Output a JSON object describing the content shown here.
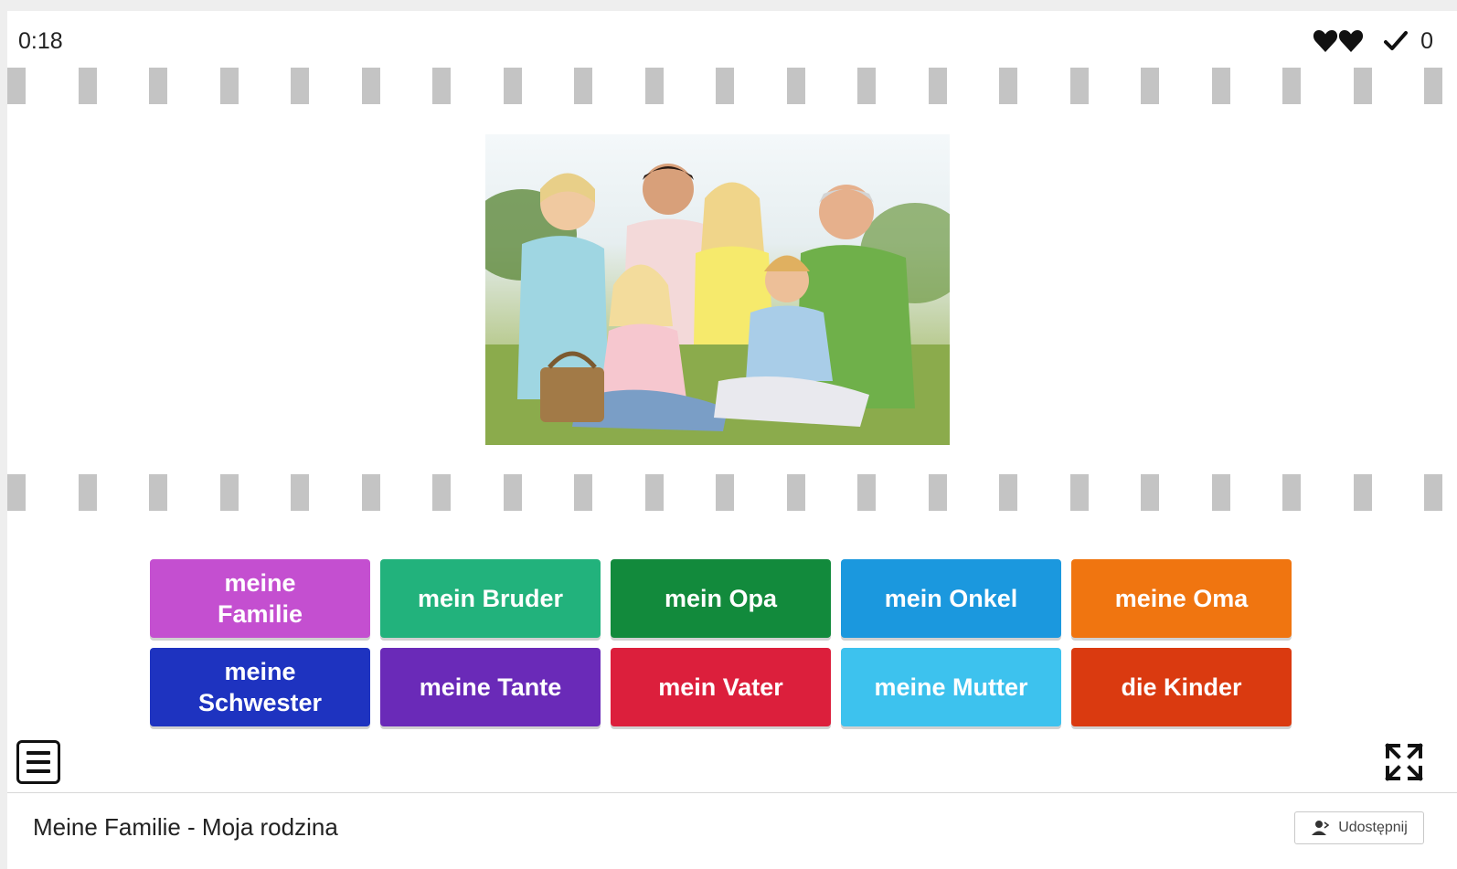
{
  "status": {
    "timer": "0:18",
    "lives": 2,
    "score": "0"
  },
  "image": {
    "alt": "family-photo"
  },
  "answers": [
    {
      "label": "meine Familie",
      "color": "#c44fd0"
    },
    {
      "label": "mein Bruder",
      "color": "#22b27c"
    },
    {
      "label": "mein Opa",
      "color": "#128a3c"
    },
    {
      "label": "mein Onkel",
      "color": "#1b98de"
    },
    {
      "label": "meine Oma",
      "color": "#f07510"
    },
    {
      "label": "meine Schwester",
      "color": "#1e33c0"
    },
    {
      "label": "meine Tante",
      "color": "#6a2ab8"
    },
    {
      "label": "mein Vater",
      "color": "#dc1f3c"
    },
    {
      "label": "meine Mutter",
      "color": "#3dc2ee"
    },
    {
      "label": "die Kinder",
      "color": "#da3a10"
    }
  ],
  "footer": {
    "title": "Meine Familie - Moja rodzina",
    "share_label": "Udostępnij"
  },
  "icons": {
    "menu": "hamburger-menu-icon",
    "fullscreen": "fullscreen-icon",
    "share": "user-share-icon",
    "lives": "heart-icon",
    "score": "checkmark-icon"
  }
}
